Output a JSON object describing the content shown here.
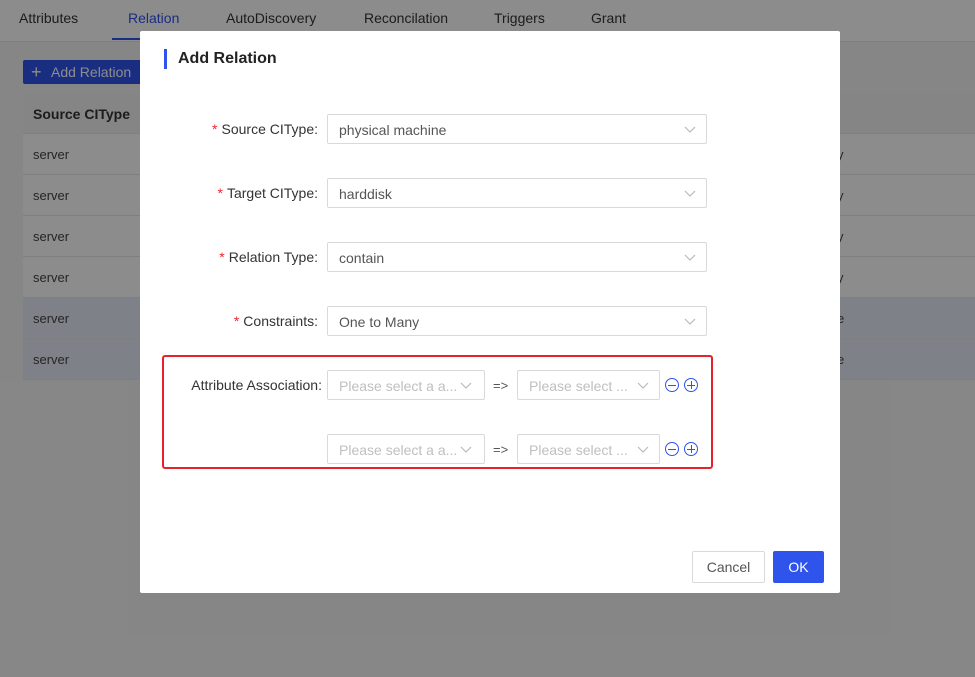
{
  "tabs": [
    {
      "label": "Attributes"
    },
    {
      "label": "Relation"
    },
    {
      "label": "AutoDiscovery"
    },
    {
      "label": "Reconcilation"
    },
    {
      "label": "Triggers"
    },
    {
      "label": "Grant"
    }
  ],
  "active_tab": "Relation",
  "add_button": {
    "label": "Add Relation",
    "icon": "plus-icon"
  },
  "table": {
    "header": "Source CIType",
    "rows": [
      {
        "source": "server",
        "tail": "y"
      },
      {
        "source": "server",
        "tail": "y"
      },
      {
        "source": "server",
        "tail": "y"
      },
      {
        "source": "server",
        "tail": "y"
      },
      {
        "source": "server",
        "tail": "e"
      },
      {
        "source": "server",
        "tail": "e"
      }
    ]
  },
  "modal": {
    "title": "Add Relation",
    "fields": {
      "source_citype": {
        "label": "Source CIType",
        "value": "physical machine"
      },
      "target_citype": {
        "label": "Target CIType",
        "value": "harddisk"
      },
      "relation_type": {
        "label": "Relation Type",
        "value": "contain"
      },
      "constraints": {
        "label": "Constraints",
        "value": "One to Many"
      }
    },
    "label_colon": ":",
    "required_mark": "*",
    "attribute_association": {
      "label": "Attribute Association",
      "separator": "=>",
      "rows": [
        {
          "left_placeholder": "Please select a a...",
          "right_placeholder": "Please select ..."
        },
        {
          "left_placeholder": "Please select a a...",
          "right_placeholder": "Please select ..."
        }
      ]
    },
    "cancel_label": "Cancel",
    "ok_label": "OK"
  },
  "colors": {
    "accent": "#2f54eb",
    "required": "#f5222d",
    "highlight": "#e8222d"
  }
}
